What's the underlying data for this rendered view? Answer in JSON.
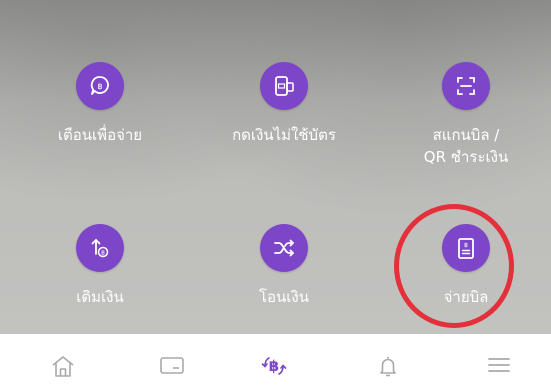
{
  "menu": {
    "tiles": [
      {
        "label": "เตือนเพื่อจ่าย",
        "icon": "bill-reminder-icon"
      },
      {
        "label": "กดเงินไม่ใช้บัตร",
        "icon": "cardless-withdrawal-icon"
      },
      {
        "label": "สแกนบิล /\nQR ชำระเงิน",
        "icon": "scan-qr-icon"
      },
      {
        "label": "เติมเงิน",
        "icon": "top-up-icon"
      },
      {
        "label": "โอนเงิน",
        "icon": "transfer-icon"
      },
      {
        "label": "จ่ายบิล",
        "icon": "pay-bill-icon"
      }
    ]
  },
  "bottom_nav": {
    "items": [
      {
        "icon": "home-icon"
      },
      {
        "icon": "card-icon"
      },
      {
        "icon": "baht-transaction-icon"
      },
      {
        "icon": "bell-icon"
      },
      {
        "icon": "menu-icon"
      }
    ]
  },
  "colors": {
    "accent": "#7d46c8",
    "highlight": "#e3303a",
    "nav_icon": "#a9a9a9",
    "nav_active": "#7d46c8"
  }
}
